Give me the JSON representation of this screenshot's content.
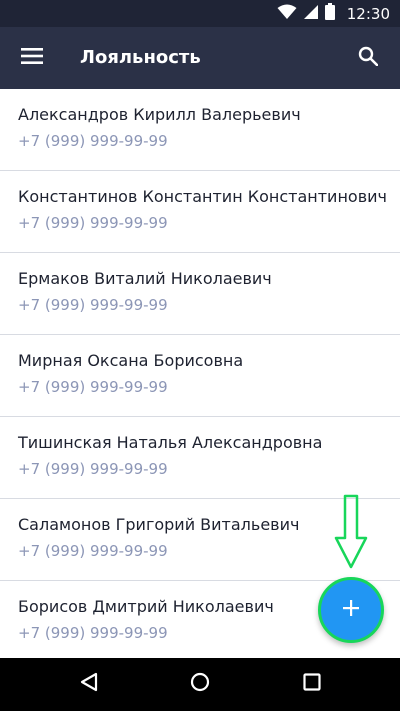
{
  "status_bar": {
    "time": "12:30",
    "icons": [
      "wifi-icon",
      "signal-icon",
      "battery-icon"
    ]
  },
  "app_bar": {
    "title": "Лояльность",
    "left_icon": "menu-icon",
    "right_icon": "search-icon"
  },
  "contacts": [
    {
      "name": "Александров Кирилл Валерьевич",
      "phone": "+7 (999) 999-99-99"
    },
    {
      "name": "Константинов Константин Константинович",
      "phone": "+7 (999) 999-99-99"
    },
    {
      "name": "Ермаков Виталий Николаевич",
      "phone": "+7 (999) 999-99-99"
    },
    {
      "name": "Мирная Оксана Борисовна",
      "phone": "+7 (999) 999-99-99"
    },
    {
      "name": "Тишинская Наталья Александровна",
      "phone": "+7 (999) 999-99-99"
    },
    {
      "name": "Саламонов Григорий Витальевич",
      "phone": "+7 (999) 999-99-99"
    },
    {
      "name": "Борисов Дмитрий Николаевич",
      "phone": "+7 (999) 999-99-99"
    }
  ],
  "fab": {
    "icon": "plus-icon"
  },
  "hint_arrow": {
    "icon": "arrow-down-icon"
  },
  "nav_bar": {
    "icons": [
      "back-icon",
      "home-icon",
      "recents-icon"
    ]
  },
  "colors": {
    "status_bar_bg": "#1f2436",
    "app_bar_bg": "#2b3147",
    "primary_text": "#1e2230",
    "secondary_text": "#8c96b6",
    "fab": "#2196f3",
    "highlight": "#18d65a"
  }
}
